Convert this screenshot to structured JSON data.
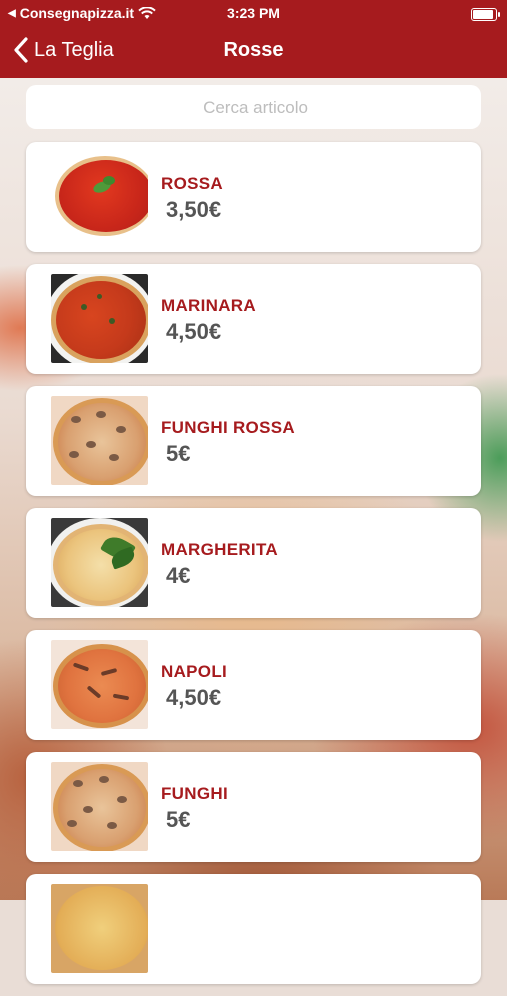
{
  "status_bar": {
    "carrier": "Consegnapizza.it",
    "time": "3:23 PM"
  },
  "nav": {
    "back_label": "La Teglia",
    "title": "Rosse"
  },
  "search": {
    "placeholder": "Cerca articolo"
  },
  "items": [
    {
      "name": "ROSSA",
      "price": "3,50€"
    },
    {
      "name": "MARINARA",
      "price": "4,50€"
    },
    {
      "name": "FUNGHI ROSSA",
      "price": "5€"
    },
    {
      "name": "MARGHERITA",
      "price": "4€"
    },
    {
      "name": "NAPOLI",
      "price": "4,50€"
    },
    {
      "name": "FUNGHI",
      "price": "5€"
    },
    {
      "name": "",
      "price": ""
    }
  ],
  "colors": {
    "brand": "#a61b1e",
    "price": "#555555",
    "card": "#ffffff"
  }
}
